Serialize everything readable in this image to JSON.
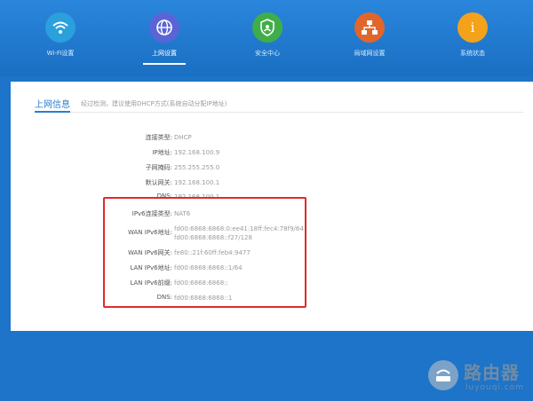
{
  "nav": [
    {
      "label": "Wi-Fi设置",
      "icon": "wifi-icon",
      "color": "#2aa0dc"
    },
    {
      "label": "上网设置",
      "icon": "globe-icon",
      "color": "#5b64d6",
      "active": true
    },
    {
      "label": "安全中心",
      "icon": "shield-icon",
      "color": "#3fae49"
    },
    {
      "label": "局域网设置",
      "icon": "network-icon",
      "color": "#e0662c"
    },
    {
      "label": "系统状态",
      "icon": "info-icon",
      "color": "#f4a21a"
    }
  ],
  "section": {
    "title": "上网信息",
    "desc": "经过检测，建议使用DHCP方式(系统自动分配IP地址)"
  },
  "rows": [
    {
      "label": "连接类型:",
      "value": "DHCP"
    },
    {
      "label": "IP地址:",
      "value": "192.168.100.9"
    },
    {
      "label": "子网掩码:",
      "value": "255.255.255.0"
    },
    {
      "label": "默认网关:",
      "value": "192.168.100.1"
    },
    {
      "label": "DNS:",
      "value": "192.168.100.1"
    },
    {
      "label": "IPv6连接类型:",
      "value": "NAT6"
    },
    {
      "label": "WAN IPv6地址:",
      "value": "fd00:6868:6868:0:ee41:18ff:fec4:78f9/64",
      "value2": "fd00:6868:6868::f27/128"
    },
    {
      "label": "WAN IPv6网关:",
      "value": "fe80::21f:60ff:feb4:9477"
    },
    {
      "label": "LAN IPv6地址:",
      "value": "fd00:6868:6868::1/64"
    },
    {
      "label": "LAN IPv6前缀:",
      "value": "fd00:6868:6868::"
    },
    {
      "label": "DNS:",
      "value": "fd00:6868:6868::1"
    }
  ],
  "watermark": {
    "title": "路由器",
    "sub": "luyouqi.com"
  },
  "colors": {
    "accent": "#2a7dd1",
    "highlight": "#e02a2a"
  }
}
